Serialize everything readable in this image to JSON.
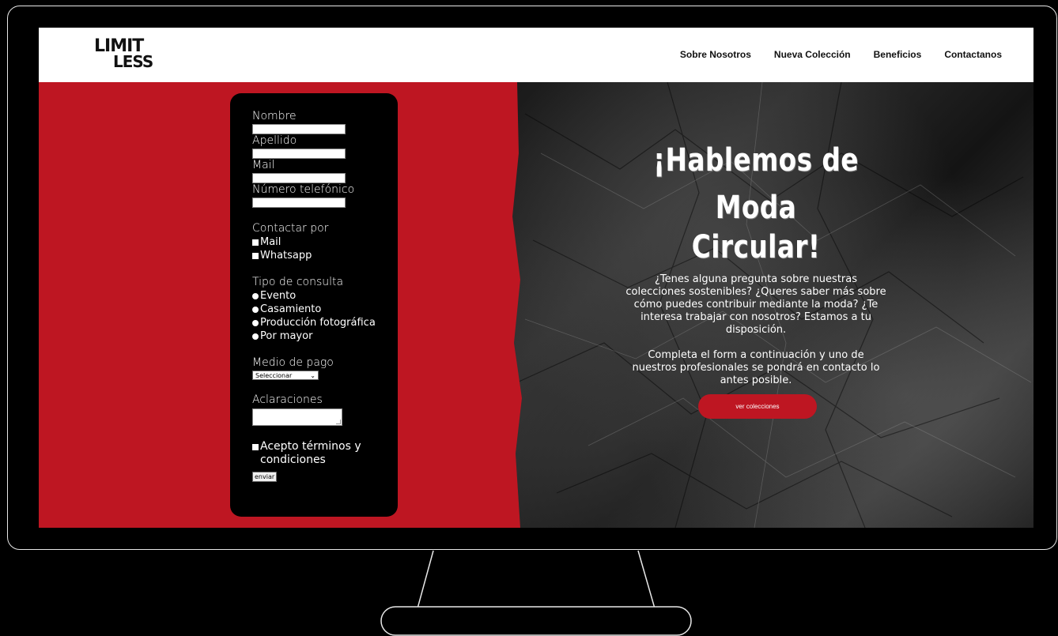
{
  "brand": {
    "logo_line1": "LIMIT",
    "logo_line2": "LESS"
  },
  "nav": {
    "items": [
      "Sobre Nosotros",
      "Nueva Colección",
      "Beneficios",
      "Contactanos"
    ]
  },
  "form": {
    "name_label": "Nombre",
    "surname_label": "Apellido",
    "mail_label": "Mail",
    "phone_label": "Número telefónico",
    "contact_label": "Contactar por",
    "contact_options": [
      "Mail",
      "Whatsapp"
    ],
    "query_label": "Tipo de consulta",
    "query_options": [
      "Evento",
      "Casamiento",
      "Producción fotográfica",
      "Por mayor"
    ],
    "payment_label": "Medio de pago",
    "payment_selected": "Seleccionar",
    "notes_label": "Aclaraciones",
    "terms_label": "Acepto términos y condiciones",
    "submit_label": "enviar"
  },
  "hero": {
    "title_line1": "¡Hablemos de",
    "title_line2": "Moda Circular!",
    "paragraph1": "¿Tenes alguna pregunta sobre nuestras colecciones sostenibles? ¿Queres saber más sobre cómo puedes contribuir mediante la moda? ¿Te interesa trabajar con nosotros? Estamos a tu disposición.",
    "paragraph2": "Completa el form a continuación y uno de nuestros profesionales se pondrá en contacto lo antes posible.",
    "cta_label": "ver colecciones"
  },
  "colors": {
    "accent_red": "#be1622",
    "background": "#000000",
    "header": "#ffffff"
  }
}
